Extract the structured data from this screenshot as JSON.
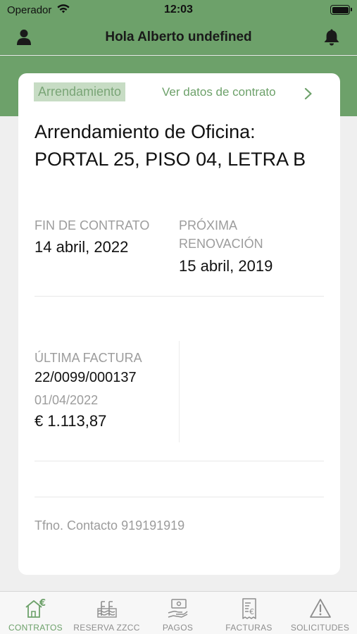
{
  "status_bar": {
    "carrier": "Operador",
    "time": "12:03"
  },
  "header": {
    "title": "Hola Alberto undefined"
  },
  "card": {
    "badge": "Arrendamiento",
    "contract_link": "Ver datos de contrato",
    "title": "Arrendamiento de Oficina: PORTAL 25, PISO 04, LETRA B",
    "contract_end": {
      "label": "FIN DE CONTRATO",
      "value": "14 abril, 2022"
    },
    "next_renewal": {
      "label": "PRÓXIMA RENOVACIÓN",
      "value": "15 abril, 2019"
    },
    "last_invoice": {
      "label": "ÚLTIMA FACTURA",
      "number": "22/0099/000137",
      "date": "01/04/2022",
      "amount": "€ 1.113,87"
    },
    "contact": "Tfno. Contacto 919191919"
  },
  "tabs": [
    {
      "label": "CONTRATOS",
      "icon": "house-euro-icon",
      "active": true
    },
    {
      "label": "RESERVA ZZCC",
      "icon": "pool-icon",
      "active": false
    },
    {
      "label": "PAGOS",
      "icon": "hand-money-icon",
      "active": false
    },
    {
      "label": "FACTURAS",
      "icon": "invoice-euro-icon",
      "active": false
    },
    {
      "label": "SOLICITUDES",
      "icon": "warning-icon",
      "active": false
    }
  ],
  "colors": {
    "brand_green": "#6da16a",
    "badge_bg": "#c7dcc4",
    "muted_text": "#9c9c9c"
  }
}
